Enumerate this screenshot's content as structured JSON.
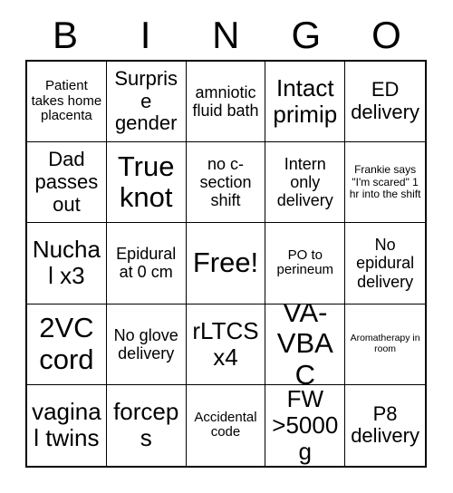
{
  "card": {
    "title": "BINGO",
    "header_letters": [
      "B",
      "I",
      "N",
      "G",
      "O"
    ],
    "free_space_label": "Free!",
    "cells": [
      {
        "text": "Patient takes home placenta",
        "size": "fs-sm",
        "marked": false,
        "free": false
      },
      {
        "text": "Surprise gender",
        "size": "fs-lg",
        "marked": false,
        "free": false
      },
      {
        "text": "amniotic fluid bath",
        "size": "fs-md",
        "marked": false,
        "free": false
      },
      {
        "text": "Intact primip",
        "size": "fs-xl",
        "marked": false,
        "free": false
      },
      {
        "text": "ED delivery",
        "size": "fs-lg",
        "marked": false,
        "free": false
      },
      {
        "text": "Dad passes out",
        "size": "fs-lg",
        "marked": false,
        "free": false
      },
      {
        "text": "True knot",
        "size": "fs-xxl",
        "marked": false,
        "free": false
      },
      {
        "text": "no c-section shift",
        "size": "fs-md",
        "marked": false,
        "free": false
      },
      {
        "text": "Intern only delivery",
        "size": "fs-md",
        "marked": false,
        "free": false
      },
      {
        "text": "Frankie says \"I'm scared\" 1 hr into the shift",
        "size": "fs-xs",
        "marked": false,
        "free": false
      },
      {
        "text": "Nuchal x3",
        "size": "fs-xl",
        "marked": false,
        "free": false
      },
      {
        "text": "Epidural at 0 cm",
        "size": "fs-md",
        "marked": false,
        "free": false
      },
      {
        "text": "Free!",
        "size": "fs-xxl",
        "marked": false,
        "free": true
      },
      {
        "text": "PO to perineum",
        "size": "fs-sm",
        "marked": false,
        "free": false
      },
      {
        "text": "No epidural delivery",
        "size": "fs-md",
        "marked": false,
        "free": false
      },
      {
        "text": "2VC cord",
        "size": "fs-xxl",
        "marked": false,
        "free": false
      },
      {
        "text": "No glove delivery",
        "size": "fs-md",
        "marked": false,
        "free": false
      },
      {
        "text": "rLTCS x4",
        "size": "fs-xl",
        "marked": false,
        "free": false
      },
      {
        "text": "VA-VBAC",
        "size": "fs-xxl",
        "marked": false,
        "free": false
      },
      {
        "text": "Aromatherapy in room",
        "size": "fs-xxs",
        "marked": false,
        "free": false
      },
      {
        "text": "vaginal twins",
        "size": "fs-xl",
        "marked": false,
        "free": false
      },
      {
        "text": "forceps",
        "size": "fs-xl",
        "marked": false,
        "free": false
      },
      {
        "text": "Accidental code",
        "size": "fs-sm",
        "marked": false,
        "free": false
      },
      {
        "text": "FW >5000g",
        "size": "fs-xl",
        "marked": false,
        "free": false
      },
      {
        "text": "P8 delivery",
        "size": "fs-lg",
        "marked": false,
        "free": false
      }
    ],
    "colors": {
      "background": "#ffffff",
      "border": "#000000",
      "text": "#000000"
    }
  }
}
